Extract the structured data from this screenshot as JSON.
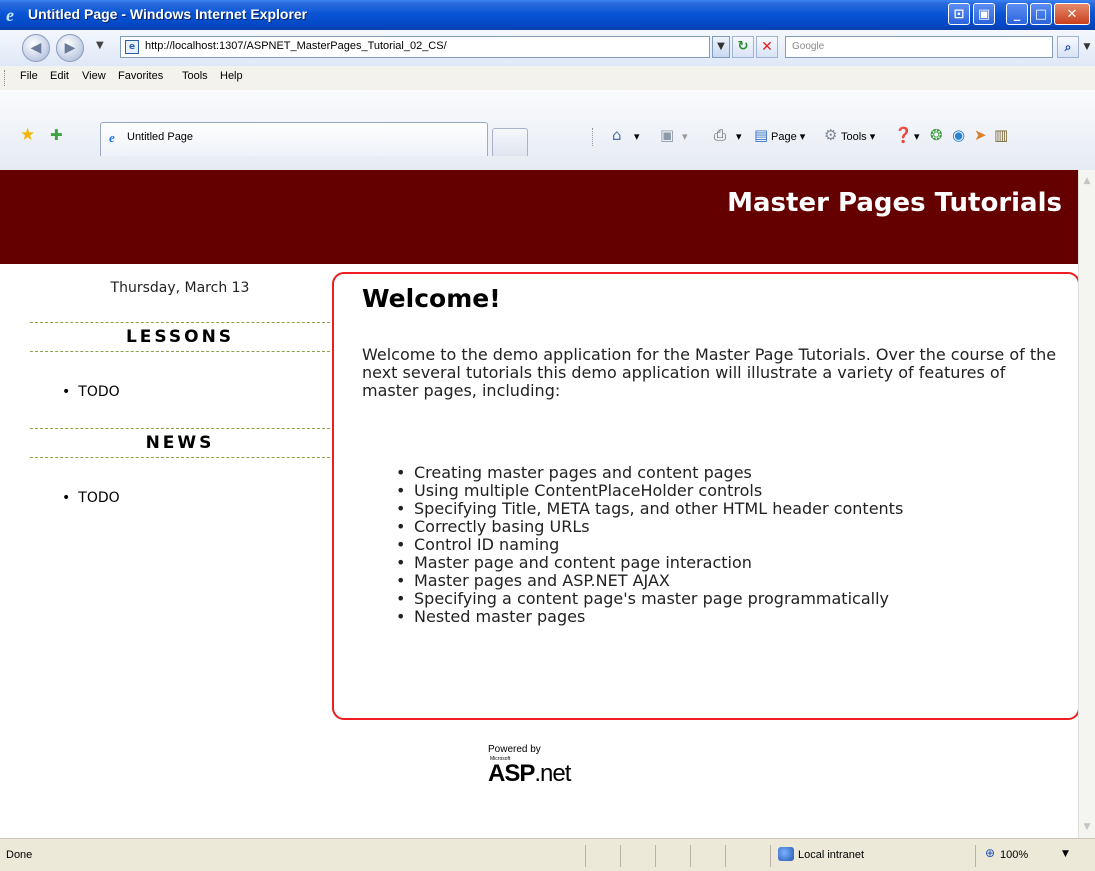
{
  "window": {
    "title": "Untitled Page - Windows Internet Explorer",
    "buttons": [
      "⊡",
      "▣",
      "_",
      "□",
      "✕"
    ]
  },
  "address": {
    "url": "http://localhost:1307/ASPNET_MasterPages_Tutorial_02_CS/",
    "search_placeholder": "Google"
  },
  "menu": {
    "items": [
      "File",
      "Edit",
      "View",
      "Favorites",
      "Tools",
      "Help"
    ]
  },
  "tabs": {
    "active_label": "Untitled Page"
  },
  "command_bar": {
    "page_label": "Page",
    "tools_label": "Tools"
  },
  "site": {
    "title": "Master Pages Tutorials"
  },
  "sidebar": {
    "date": "Thursday, March 13",
    "lessons_heading": "LESSONS",
    "lessons_items": [
      "TODO"
    ],
    "news_heading": "NEWS",
    "news_items": [
      "TODO"
    ]
  },
  "main": {
    "heading": "Welcome!",
    "intro": "Welcome to the demo application for the Master Page Tutorials. Over the course of the next several tutorials this demo application will illustrate a variety of features of master pages, including:",
    "features": [
      " Creating master pages and content pages",
      "Using multiple ContentPlaceHolder controls",
      "Specifying Title, META tags, and other HTML header contents",
      "Correctly basing URLs",
      "Control ID naming",
      "Master page and content page interaction",
      "Master pages and ASP.NET AJAX",
      "Specifying a content page's master page programmatically",
      "Nested master pages"
    ]
  },
  "footer": {
    "powered_by": "Powered by",
    "microsoft": "Microsoft",
    "aspnet_bold": "ASP",
    "aspnet_rest": ".net"
  },
  "status": {
    "text": "Done",
    "zone": "Local intranet",
    "zoom": "100%"
  },
  "colors": {
    "header_bg": "#650000",
    "box_border": "#ef1d1d",
    "section_rule": "#8aa24c"
  }
}
